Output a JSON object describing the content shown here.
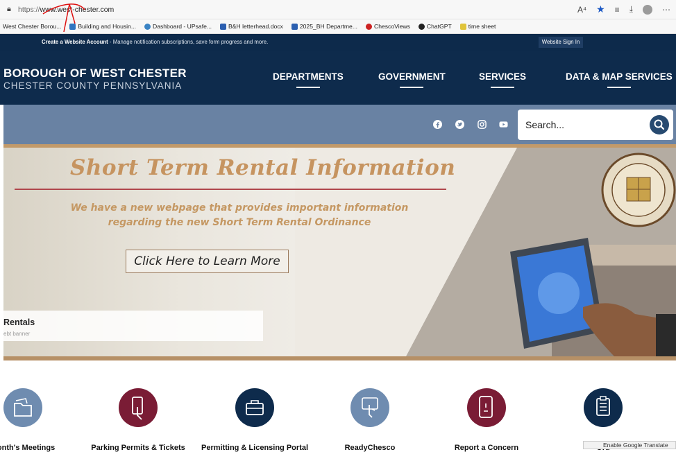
{
  "browser": {
    "url_prefix": "https://",
    "url_host": "www.west-chester.com",
    "bookmarks": [
      {
        "label": "West Chester Borou...",
        "color": "#8a8a8a"
      },
      {
        "label": "Building and Housin...",
        "color": "#2f74c0"
      },
      {
        "label": "Dashboard - UPsafe...",
        "color": "#3a83c4"
      },
      {
        "label": "B&H letterhead.docx",
        "color": "#2b5fb0"
      },
      {
        "label": "2025_BH Departme...",
        "color": "#2b5fb0"
      },
      {
        "label": "ChescoViews",
        "color": "#c22"
      },
      {
        "label": "ChatGPT",
        "color": "#222"
      },
      {
        "label": "time sheet",
        "color": "#e0c43a"
      }
    ],
    "toolbar_icons": [
      "reader-icon",
      "favorite-star-icon",
      "favorites-list-icon",
      "download-icon",
      "profile-icon",
      "more-icon"
    ]
  },
  "site": {
    "utility": {
      "account_link": "Create a Website Account",
      "account_desc": " - Manage notification subscriptions, save form progress and more.",
      "signin": "Website Sign In"
    },
    "brand": {
      "line1": "BOROUGH OF WEST CHESTER",
      "line2": "CHESTER COUNTY PENNSYLVANIA"
    },
    "nav": [
      "DEPARTMENTS",
      "GOVERNMENT",
      "SERVICES",
      "DATA & MAP SERVICES"
    ],
    "social": [
      "facebook-icon",
      "twitter-icon",
      "instagram-icon",
      "youtube-icon"
    ],
    "search": {
      "placeholder": "Search..."
    },
    "hero": {
      "title": "Short Term Rental Information",
      "subtitle_line1": "We have a new webpage that provides important information",
      "subtitle_line2": "regarding the new Short Term Rental Ordinance",
      "cta": "Click Here to Learn More",
      "caption_title": "Rentals",
      "caption_sub": "ebt banner"
    },
    "quick_links": [
      {
        "label": "Month's Meetings",
        "color": "#6f8cb0",
        "icon": "folder-icon"
      },
      {
        "label": "Parking Permits & Tickets",
        "color": "#7a1c35",
        "icon": "phone-tap-icon"
      },
      {
        "label": "Permitting & Licensing Portal",
        "color": "#0e2b4c",
        "icon": "briefcase-icon"
      },
      {
        "label": "ReadyChesco",
        "color": "#6f8cb0",
        "icon": "hand-tap-icon"
      },
      {
        "label": "Report a Concern",
        "color": "#7a1c35",
        "icon": "phone-alert-icon"
      },
      {
        "label": "Ord",
        "color": "#0e2b4c",
        "icon": "clipboard-icon"
      }
    ],
    "translate": "Enable Google Translate"
  }
}
